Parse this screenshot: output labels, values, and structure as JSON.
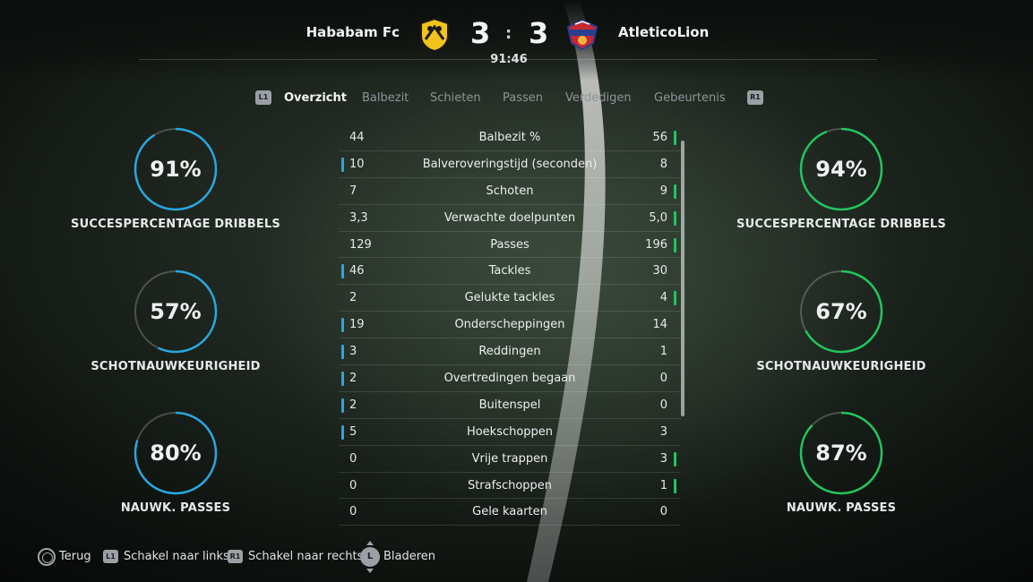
{
  "header": {
    "home_team": "Hababam Fc",
    "away_team": "AtleticoLion",
    "home_score": "3",
    "separator": ":",
    "away_score": "3",
    "clock": "91:46",
    "home_crest_icon": "bee-crest-icon",
    "away_crest_icon": "lion-crest-icon"
  },
  "tabs": {
    "left_button": "L1",
    "right_button": "R1",
    "items": [
      {
        "label": "Overzicht",
        "active": true
      },
      {
        "label": "Balbezit",
        "active": false
      },
      {
        "label": "Schieten",
        "active": false
      },
      {
        "label": "Passen",
        "active": false
      },
      {
        "label": "Verdedigen",
        "active": false
      },
      {
        "label": "Gebeurtenis",
        "active": false
      }
    ]
  },
  "home_rings": [
    {
      "value": "91%",
      "percent": 91,
      "label": "SUCCESPERCENTAGE DRIBBELS"
    },
    {
      "value": "57%",
      "percent": 57,
      "label": "SCHOTNAUWKEURIGHEID"
    },
    {
      "value": "80%",
      "percent": 80,
      "label": "NAUWK. PASSES"
    }
  ],
  "away_rings": [
    {
      "value": "94%",
      "percent": 94,
      "label": "SUCCESPERCENTAGE DRIBBELS"
    },
    {
      "value": "67%",
      "percent": 67,
      "label": "SCHOTNAUWKEURIGHEID"
    },
    {
      "value": "87%",
      "percent": 87,
      "label": "NAUWK. PASSES"
    }
  ],
  "colors": {
    "home_accent": "#2aa6df",
    "away_accent": "#22c55e"
  },
  "stats": [
    {
      "label": "Balbezit %",
      "home": "44",
      "away": "56",
      "leader": "away"
    },
    {
      "label": "Balveroveringstijd (seconden)",
      "home": "10",
      "away": "8",
      "leader": "home"
    },
    {
      "label": "Schoten",
      "home": "7",
      "away": "9",
      "leader": "away"
    },
    {
      "label": "Verwachte doelpunten",
      "home": "3,3",
      "away": "5,0",
      "leader": "away"
    },
    {
      "label": "Passes",
      "home": "129",
      "away": "196",
      "leader": "away"
    },
    {
      "label": "Tackles",
      "home": "46",
      "away": "30",
      "leader": "home"
    },
    {
      "label": "Gelukte tackles",
      "home": "2",
      "away": "4",
      "leader": "away"
    },
    {
      "label": "Onderscheppingen",
      "home": "19",
      "away": "14",
      "leader": "home"
    },
    {
      "label": "Reddingen",
      "home": "3",
      "away": "1",
      "leader": "home"
    },
    {
      "label": "Overtredingen begaan",
      "home": "2",
      "away": "0",
      "leader": "home"
    },
    {
      "label": "Buitenspel",
      "home": "2",
      "away": "0",
      "leader": "home"
    },
    {
      "label": "Hoekschoppen",
      "home": "5",
      "away": "3",
      "leader": "home"
    },
    {
      "label": "Vrije trappen",
      "home": "0",
      "away": "3",
      "leader": "away"
    },
    {
      "label": "Strafschoppen",
      "home": "0",
      "away": "1",
      "leader": "away"
    },
    {
      "label": "Gele kaarten",
      "home": "0",
      "away": "0",
      "leader": "none"
    }
  ],
  "footer": {
    "back_label": "Terug",
    "l1_button": "L1",
    "l1_label": "Schakel naar links",
    "r1_button": "R1",
    "r1_label": "Schakel naar rechts",
    "stick_button": "L",
    "scroll_label": "Bladeren"
  }
}
